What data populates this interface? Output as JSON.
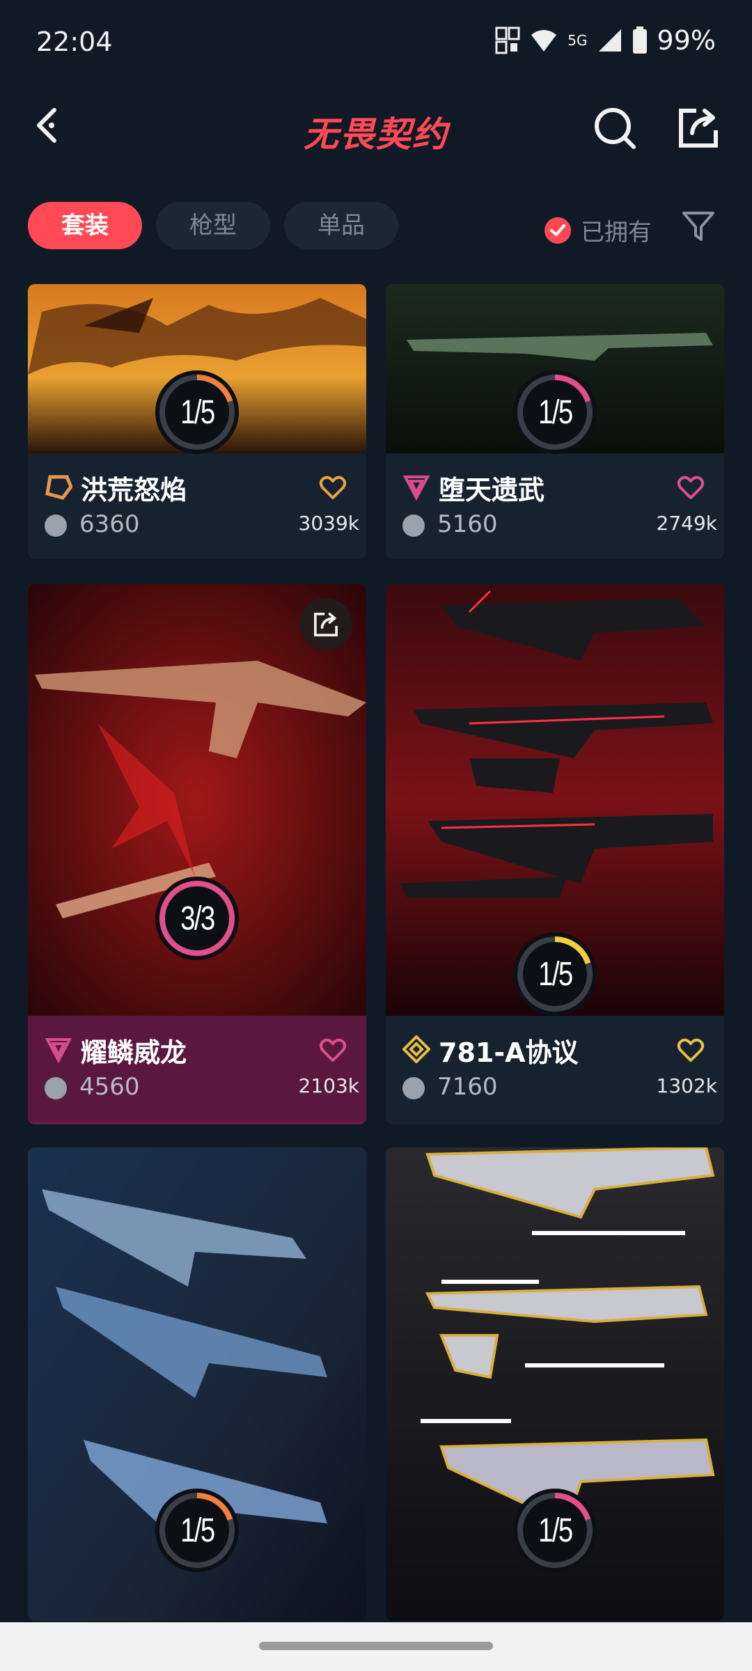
{
  "status": {
    "time": "22:04",
    "network": "5G",
    "battery": "99%"
  },
  "header": {
    "title": "无畏契约"
  },
  "tabs": [
    {
      "label": "套装",
      "active": true
    },
    {
      "label": "枪型",
      "active": false
    },
    {
      "label": "单品",
      "active": false
    }
  ],
  "owned_filter": {
    "label": "已拥有",
    "checked": true
  },
  "cards": [
    {
      "name": "洪荒怒焰",
      "price": "6360",
      "likes": "3039k",
      "progress": "1/5",
      "tier": "orange",
      "tier_color": "#e8964a",
      "heart_color": "#f0a040",
      "ring_color": "#f08040"
    },
    {
      "name": "堕天遗武",
      "price": "5160",
      "likes": "2749k",
      "progress": "1/5",
      "tier": "pink",
      "tier_color": "#d64d8c",
      "heart_color": "#e0508a",
      "ring_color": "#e0508a"
    },
    {
      "name": "耀鳞威龙",
      "price": "4560",
      "likes": "2103k",
      "progress": "3/3",
      "tier": "pink",
      "tier_color": "#d64d8c",
      "heart_color": "#e0508a",
      "ring_color": "#e0508a",
      "highlight": true
    },
    {
      "name": "781-A协议",
      "price": "7160",
      "likes": "1302k",
      "progress": "1/5",
      "tier": "gold",
      "tier_color": "#e8c040",
      "heart_color": "#e8c040",
      "ring_color": "#f0d040"
    },
    {
      "name": "",
      "price": "",
      "likes": "",
      "progress": "1/5",
      "ring_color": "#f08040"
    },
    {
      "name": "",
      "price": "",
      "likes": "",
      "progress": "1/5",
      "ring_color": "#e0508a"
    }
  ]
}
